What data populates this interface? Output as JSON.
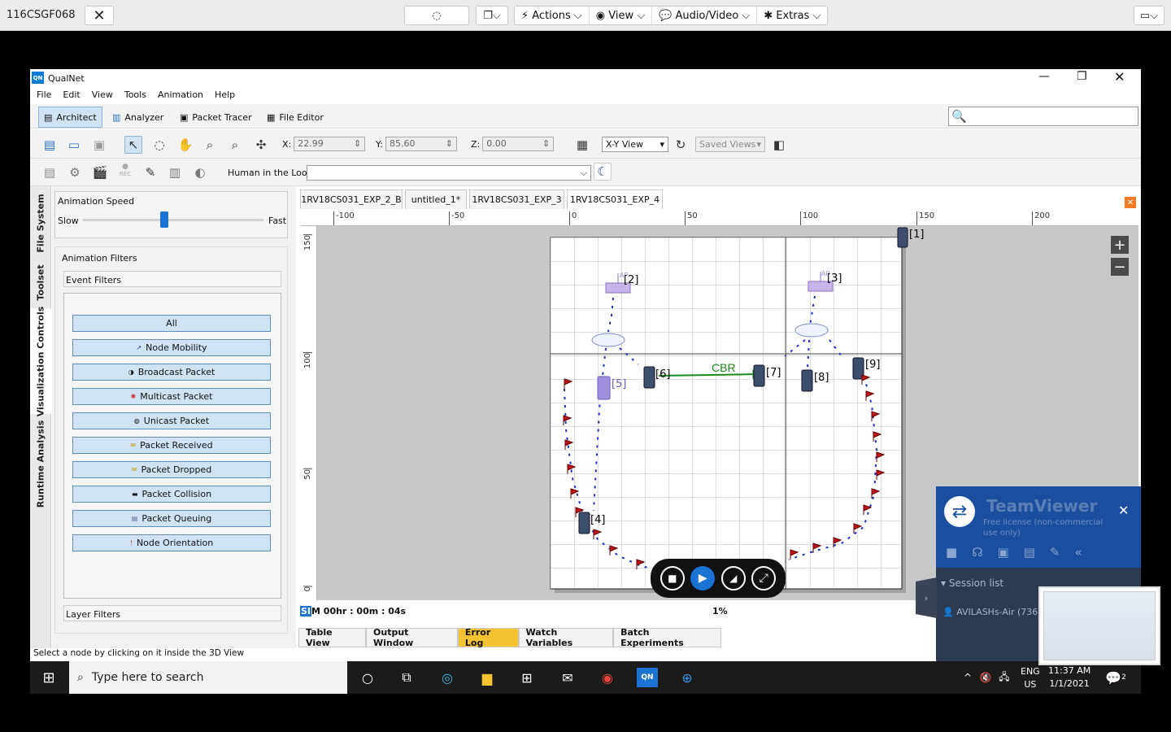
{
  "remote": {
    "host": "116CSGF068",
    "menus": [
      "Actions",
      "View",
      "Audio/Video",
      "Extras"
    ]
  },
  "app": {
    "title": "QualNet",
    "logo": "QN"
  },
  "menubar": [
    "File",
    "Edit",
    "View",
    "Tools",
    "Animation",
    "Help"
  ],
  "perspectives": {
    "architect": "Architect",
    "analyzer": "Analyzer",
    "packet_tracer": "Packet Tracer",
    "file_editor": "File Editor"
  },
  "coords": {
    "x_label": "X:",
    "x": "22.99",
    "y_label": "Y:",
    "y": "85.60",
    "z_label": "Z:",
    "z": "0.00"
  },
  "view_select": "X-Y View",
  "saved_views": "Saved Views",
  "toolbar2": {
    "rec": "REC",
    "hitl_label": "Human in the Loop:"
  },
  "side_tabs": [
    "File System",
    "Toolset",
    "Visualization Controls",
    "Runtime Analysis"
  ],
  "anim": {
    "title": "Animation Speed",
    "slow": "Slow",
    "fast": "Fast",
    "speed": 0.45
  },
  "filters": {
    "title": "Animation Filters",
    "event": "Event Filters",
    "layer": "Layer Filters",
    "buttons": [
      "All",
      "Node Mobility",
      "Broadcast Packet",
      "Multicast Packet",
      "Unicast Packet",
      "Packet Received",
      "Packet Dropped",
      "Packet Collision",
      "Packet Queuing",
      "Node Orientation"
    ]
  },
  "doc_tabs": [
    "1RV18CS031_EXP_2_B",
    "untitled_1*",
    "1RV18CS031_EXP_3",
    "1RV18CS031_EXP_4"
  ],
  "ruler_h": [
    "-100",
    "-50",
    "0",
    "50",
    "100",
    "150",
    "200"
  ],
  "ruler_v": [
    "150",
    "100",
    "50",
    "0"
  ],
  "nodes": {
    "n1": "[1]",
    "n2": "[2]",
    "n3": "[3]",
    "n4": "[4]",
    "n5": "[5]",
    "n6": "[6]",
    "n7": "[7]",
    "n8": "[8]",
    "n9": "[9]",
    "ap": "AP"
  },
  "link_label": "CBR",
  "sim": {
    "prefix": "SI",
    "time": "M 00hr : 00m : 04s",
    "progress": "1%"
  },
  "bottom_tabs": [
    "Table View",
    "Output Window",
    "Error Log",
    "Watch Variables",
    "Batch Experiments"
  ],
  "status": "Select a node by clicking on it inside the 3D View",
  "teamviewer": {
    "name": "TeamViewer",
    "license": "Free license (non-commercial use only)",
    "session": "Session list",
    "user": "AVILASHs-Air (736"
  },
  "taskbar": {
    "search": "Type here to search",
    "lang1": "ENG",
    "lang2": "US",
    "time": "11:37 AM",
    "date": "1/1/2021",
    "notif": "2"
  }
}
